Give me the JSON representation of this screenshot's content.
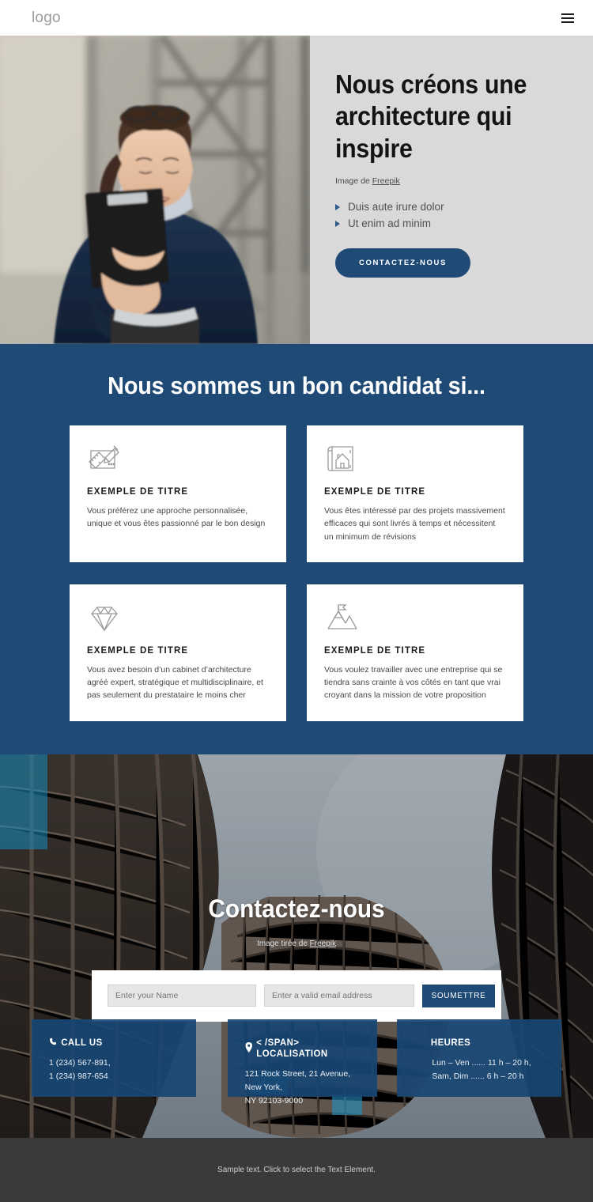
{
  "header": {
    "logo": "logo",
    "menu_icon": "hamburger-menu-icon"
  },
  "hero": {
    "title": "Nous créons une architecture qui inspire",
    "credit_prefix": "Image de ",
    "credit_link": "Freepik",
    "bullets": [
      "Duis aute irure dolor",
      "Ut enim ad minim"
    ],
    "cta_label": "CONTACTEZ-NOUS",
    "image_alt": "Femme professionnelle en blazer bleu marine tenant un porte-bloc"
  },
  "features": {
    "heading": "Nous sommes un bon candidat si...",
    "cards": [
      {
        "icon": "drafting-ruler-pencil-icon",
        "title": "EXEMPLE DE TITRE",
        "text": "Vous préférez une approche personnalisée, unique et vous êtes passionné par le bon design"
      },
      {
        "icon": "blueprint-house-plan-icon",
        "title": "EXEMPLE DE TITRE",
        "text": "Vous êtes intéressé par des projets massivement efficaces qui sont livrés à temps et nécessitent un minimum de révisions"
      },
      {
        "icon": "diamond-icon",
        "title": "EXEMPLE DE TITRE",
        "text": "Vous avez besoin d’un cabinet d’architecture agréé expert, stratégique et multidisciplinaire, et pas seulement du prestataire le moins cher"
      },
      {
        "icon": "mountain-flag-icon",
        "title": "EXEMPLE DE TITRE",
        "text": "Vous voulez travailler avec une entreprise qui se tiendra sans crainte à vos côtés en tant que vrai croyant dans la mission de votre proposition"
      }
    ]
  },
  "contact": {
    "heading": "Contactez-nous",
    "credit_prefix": "Image tirée de ",
    "credit_link": "Freepik",
    "image_alt": "Façade courbe d'un immeuble moderne vue depuis le bas",
    "form": {
      "name_placeholder": "Enter your Name",
      "name_value": "",
      "email_placeholder": "Enter a valid email address",
      "email_value": "",
      "submit_label": "SOUMETTRE"
    },
    "info_boxes": [
      {
        "icon": "phone-icon",
        "title": "CALL US",
        "lines": [
          "1 (234) 567-891,",
          "1 (234) 987-654"
        ]
      },
      {
        "icon": "map-pin-icon",
        "title": "< /SPAN> LOCALISATION",
        "lines": [
          "121 Rock Street, 21 Avenue, New York,",
          "NY 92103-9000"
        ]
      },
      {
        "icon": "",
        "title": "HEURES",
        "lines": [
          "Lun – Ven ...... 11 h – 20 h, Sam, Dim ...... 6 h – 20 h"
        ]
      }
    ]
  },
  "footer": {
    "text": "Sample text. Click to select the Text Element."
  },
  "colors": {
    "brand_blue": "#1f4a75",
    "hero_panel_gray": "#d9d9d9",
    "footer_gray": "#3a3a3a",
    "card_white": "#ffffff"
  }
}
